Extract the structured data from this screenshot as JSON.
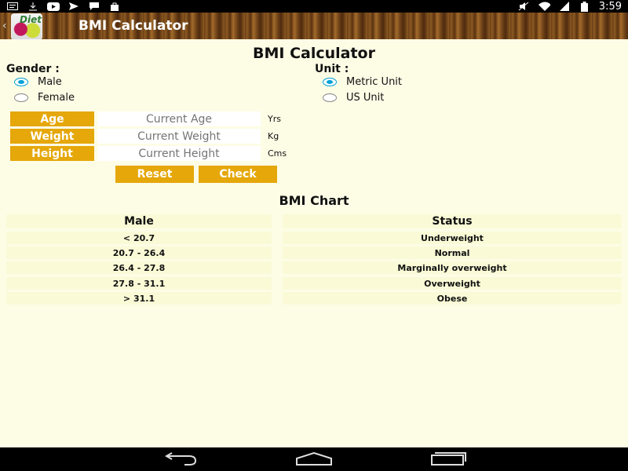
{
  "status_bar": {
    "time": "3:59"
  },
  "action_bar": {
    "title": "BMI Calculator",
    "app_icon_text": "Diet"
  },
  "page_title": "BMI Calculator",
  "gender": {
    "label": "Gender :",
    "options": [
      "Male",
      "Female"
    ],
    "selected": "Male"
  },
  "unit": {
    "label": "Unit :",
    "options": [
      "Metric Unit",
      "US Unit"
    ],
    "selected": "Metric Unit"
  },
  "fields": [
    {
      "label": "Age",
      "placeholder": "Current Age",
      "unit": "Yrs"
    },
    {
      "label": "Weight",
      "placeholder": "Current Weight",
      "unit": "Kg"
    },
    {
      "label": "Height",
      "placeholder": "Current Height",
      "unit": "Cms"
    }
  ],
  "buttons": {
    "reset": "Reset",
    "check": "Check"
  },
  "chart": {
    "title": "BMI Chart",
    "headers": [
      "Male",
      "Status"
    ],
    "rows": [
      [
        "< 20.7",
        "Underweight"
      ],
      [
        "20.7 - 26.4",
        "Normal"
      ],
      [
        "26.4 - 27.8",
        "Marginally overweight"
      ],
      [
        "27.8 - 31.1",
        "Overweight"
      ],
      [
        "> 31.1",
        "Obese"
      ]
    ]
  },
  "colors": {
    "accent": "#e5a70a",
    "background": "#fdfde6",
    "radio_selected": "#00a0d6"
  }
}
